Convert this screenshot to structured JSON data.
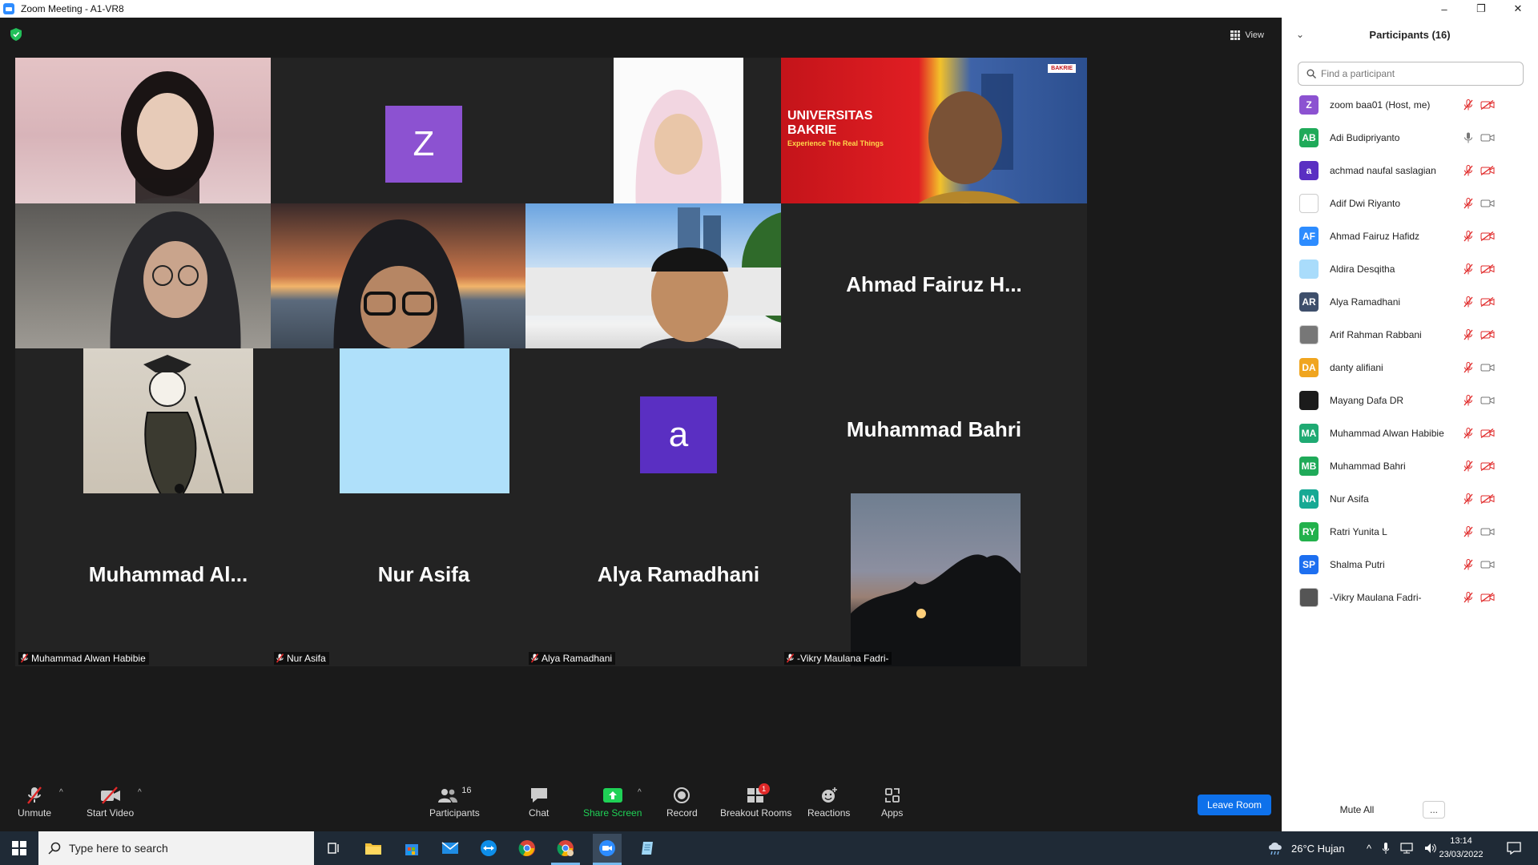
{
  "window": {
    "title": "Zoom Meeting - A1-VR8",
    "minimize_glyph": "–",
    "restore_glyph": "❐",
    "close_glyph": "✕"
  },
  "topbar": {
    "view_label": "View"
  },
  "tiles": [
    {
      "name": "Mayang Dafa DR",
      "kind": "photo"
    },
    {
      "name": "zoom baa01",
      "kind": "avatar",
      "letter": "Z",
      "color": "#8c52d1"
    },
    {
      "name": "Shalma Putri",
      "kind": "photo"
    },
    {
      "name": "Adi Budipriyanto",
      "kind": "photo",
      "active": true,
      "banner_title": "UNIVERSITAS BAKRIE",
      "banner_sub": "Experience The Real Things",
      "logo_text": "BAKRIE"
    },
    {
      "name": "danty alifiani",
      "kind": "photo"
    },
    {
      "name": "Ratri Yunita L",
      "kind": "photo"
    },
    {
      "name": "Adif Dwi Riyanto",
      "kind": "photo"
    },
    {
      "name": "Ahmad Fairuz Hafidz",
      "kind": "name",
      "display": "Ahmad  Fairuz  H..."
    },
    {
      "name": "Arif Rahman Rabbani",
      "kind": "photo"
    },
    {
      "name": "Aldira Desqitha",
      "kind": "photo"
    },
    {
      "name": "achmad naufal saslagian",
      "kind": "avatar",
      "letter": "a",
      "color": "#5a2fc2"
    },
    {
      "name": "Muhammad Bahri",
      "kind": "name",
      "display": "Muhammad Bahri"
    },
    {
      "name": "Muhammad Alwan Habibie",
      "kind": "name",
      "display": "Muhammad  Al..."
    },
    {
      "name": "Nur Asifa",
      "kind": "name",
      "display": "Nur Asifa"
    },
    {
      "name": "Alya Ramadhani",
      "kind": "name",
      "display": "Alya Ramadhani"
    },
    {
      "name": "-Vikry Maulana Fadri-",
      "kind": "photo"
    }
  ],
  "toolbar": {
    "unmute": "Unmute",
    "start_video": "Start Video",
    "participants": "Participants",
    "participants_count": "16",
    "chat": "Chat",
    "share_screen": "Share Screen",
    "record": "Record",
    "breakout_rooms": "Breakout Rooms",
    "breakout_badge": "1",
    "reactions": "Reactions",
    "apps": "Apps",
    "leave": "Leave Room",
    "caret": "^"
  },
  "colors": {
    "share_green": "#1fd156",
    "leave_blue": "#0e71eb",
    "muted_red": "#e02828",
    "active_outline": "#f6e23a"
  },
  "panel": {
    "title": "Participants (16)",
    "search_placeholder": "Find a participant",
    "mute_all": "Mute All",
    "more": "...",
    "participants": [
      {
        "name": "zoom baa01 (Host, me)",
        "initials": "Z",
        "color": "#8c52d1",
        "mic": "muted",
        "cam": "off"
      },
      {
        "name": "Adi Budipriyanto",
        "initials": "AB",
        "color": "#1faa59",
        "mic": "on",
        "cam": "on"
      },
      {
        "name": "achmad naufal saslagian",
        "initials": "a",
        "color": "#5a2fc2",
        "mic": "muted",
        "cam": "off"
      },
      {
        "name": "Adif Dwi Riyanto",
        "initials": "",
        "color": "#ffffff",
        "mic": "muted",
        "cam": "on",
        "photo": true
      },
      {
        "name": "Ahmad Fairuz Hafidz",
        "initials": "AF",
        "color": "#2d8cff",
        "mic": "muted",
        "cam": "off"
      },
      {
        "name": "Aldira Desqitha",
        "initials": "",
        "color": "#a9dcfb",
        "mic": "muted",
        "cam": "off"
      },
      {
        "name": "Alya Ramadhani",
        "initials": "AR",
        "color": "#3e4f6b",
        "mic": "muted",
        "cam": "off"
      },
      {
        "name": "Arif Rahman Rabbani",
        "initials": "",
        "color": "#777777",
        "mic": "muted",
        "cam": "off",
        "photo": true
      },
      {
        "name": "danty alifiani",
        "initials": "DA",
        "color": "#f0a51f",
        "mic": "muted",
        "cam": "on"
      },
      {
        "name": "Mayang Dafa DR",
        "initials": "",
        "color": "#1b1b1b",
        "mic": "muted",
        "cam": "on"
      },
      {
        "name": "Muhammad Alwan Habibie",
        "initials": "MA",
        "color": "#1faa73",
        "mic": "muted",
        "cam": "off"
      },
      {
        "name": "Muhammad Bahri",
        "initials": "MB",
        "color": "#1faa59",
        "mic": "muted",
        "cam": "off"
      },
      {
        "name": "Nur Asifa",
        "initials": "NA",
        "color": "#17a994",
        "mic": "muted",
        "cam": "off"
      },
      {
        "name": "Ratri Yunita L",
        "initials": "RY",
        "color": "#22b14c",
        "mic": "muted",
        "cam": "on"
      },
      {
        "name": "Shalma Putri",
        "initials": "SP",
        "color": "#1d6ff0",
        "mic": "muted",
        "cam": "on"
      },
      {
        "name": "-Vikry Maulana Fadri-",
        "initials": "",
        "color": "#555555",
        "mic": "muted",
        "cam": "off",
        "photo": true
      }
    ]
  },
  "taskbar": {
    "search_placeholder": "Type here to search",
    "weather": "26°C  Hujan",
    "time": "13:14",
    "date": "23/03/2022"
  }
}
